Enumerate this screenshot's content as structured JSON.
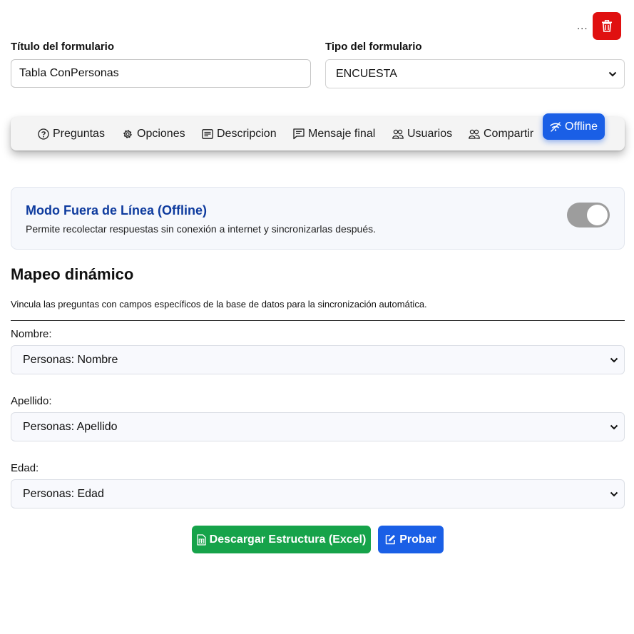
{
  "header": {
    "more_label": "..."
  },
  "form": {
    "title_label": "Título del formulario",
    "title_value": "Tabla ConPersonas",
    "type_label": "Tipo del formulario",
    "type_value": "ENCUESTA"
  },
  "tabs": [
    {
      "label": "Preguntas",
      "icon": "question-circle-icon"
    },
    {
      "label": "Opciones",
      "icon": "gear-icon"
    },
    {
      "label": "Descripcion",
      "icon": "card-text-icon"
    },
    {
      "label": "Mensaje final",
      "icon": "chat-icon"
    },
    {
      "label": "Usuarios",
      "icon": "people-icon"
    },
    {
      "label": "Compartir",
      "icon": "people-icon"
    },
    {
      "label": "Offline",
      "icon": "wifi-off-icon",
      "active": true
    }
  ],
  "offline": {
    "title": "Modo Fuera de Línea (Offline)",
    "description": "Permite recolectar respuestas sin conexión a internet y sincronizarlas después.",
    "enabled": true
  },
  "mapping": {
    "title": "Mapeo dinámico",
    "description": "Vincula las preguntas con campos específicos de la base de datos para la sincronización automática.",
    "fields": [
      {
        "label": "Nombre:",
        "value": "Personas: Nombre"
      },
      {
        "label": "Apellido:",
        "value": "Personas: Apellido"
      },
      {
        "label": "Edad:",
        "value": "Personas: Edad"
      }
    ]
  },
  "actions": {
    "download_label": "Descargar Estructura (Excel)",
    "test_label": "Probar"
  },
  "colors": {
    "primary": "#1a5fe6",
    "danger": "#e01010",
    "success": "#16a34a",
    "offline_title": "#0e3b9e"
  }
}
